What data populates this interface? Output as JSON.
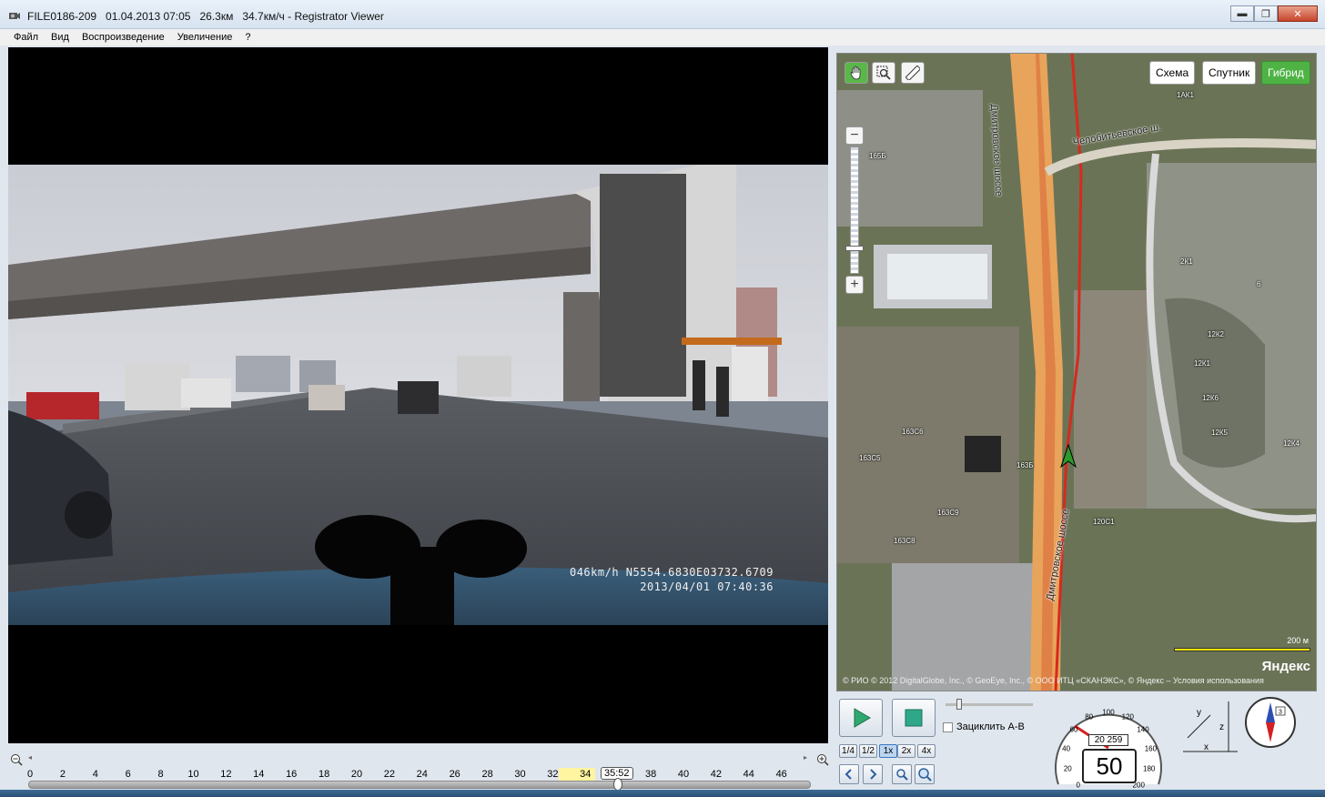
{
  "window": {
    "title": "FILE0186-209   01.04.2013 07:05   26.3км   34.7км/ч - Registrator Viewer",
    "controls": {
      "minimize": "▬",
      "maximize": "❐",
      "close": "✕"
    }
  },
  "menu": {
    "items": [
      "Файл",
      "Вид",
      "Воспроизведение",
      "Увеличение",
      "?"
    ]
  },
  "video": {
    "osd_line1": "046km/h N5554.6830E03732.6709",
    "osd_line2": "2013/04/01 07:40:36"
  },
  "map": {
    "tools": [
      "hand-icon",
      "zoom-select-icon",
      "ruler-icon"
    ],
    "types": [
      {
        "label": "Схема",
        "active": false
      },
      {
        "label": "Спутник",
        "active": false
      },
      {
        "label": "Гибрид",
        "active": true
      }
    ],
    "zoom_in": "+",
    "zoom_out": "−",
    "roads": {
      "dmitrovskoe_top": "Дмитровское шоссе",
      "dmitrovskoe_bottom": "Дмитровское шоссе",
      "chelobityevskoe": "Челобитьевское ш."
    },
    "building_labels": [
      {
        "id": "b1",
        "text": "1АК1"
      },
      {
        "id": "b2",
        "text": "165Б"
      },
      {
        "id": "b3",
        "text": "2К1"
      },
      {
        "id": "b4",
        "text": "6"
      },
      {
        "id": "b5",
        "text": "12К2"
      },
      {
        "id": "b6",
        "text": "12К1"
      },
      {
        "id": "b7",
        "text": "12К6"
      },
      {
        "id": "b8",
        "text": "12К5"
      },
      {
        "id": "b9",
        "text": "12К4"
      },
      {
        "id": "b10",
        "text": "163С6"
      },
      {
        "id": "b11",
        "text": "163С5"
      },
      {
        "id": "b12",
        "text": "163Б"
      },
      {
        "id": "b13",
        "text": "163С9"
      },
      {
        "id": "b14",
        "text": "120С1"
      },
      {
        "id": "b15",
        "text": "163С8"
      }
    ],
    "scale": "200 м",
    "brand": "Яндекс",
    "copyright": "© РИО   © 2012 DigitalGlobe, Inc., © GeoEye, Inc., © ООО ИТЦ «СКАНЭКС», © Яндекс – Условия использования"
  },
  "timeline": {
    "zoom_out_icon": "zoom-out-icon",
    "zoom_in_icon": "zoom-in-icon",
    "ticks": [
      "0",
      "2",
      "4",
      "6",
      "8",
      "10",
      "12",
      "14",
      "16",
      "18",
      "20",
      "22",
      "24",
      "26",
      "28",
      "30",
      "32",
      "34",
      "36",
      "38",
      "40",
      "42",
      "44",
      "46"
    ],
    "current_time": "35:52"
  },
  "controls": {
    "play": "play-icon",
    "stop": "stop-icon",
    "loop_label": "Зациклить А-В",
    "speeds": [
      {
        "label": "1/4",
        "active": false
      },
      {
        "label": "1/2",
        "active": false
      },
      {
        "label": "1x",
        "active": true
      },
      {
        "label": "2x",
        "active": false
      },
      {
        "label": "4x",
        "active": false
      }
    ],
    "speedometer": {
      "odometer": "20 259",
      "speed_limit": "50",
      "scale": [
        "0",
        "20",
        "40",
        "60",
        "80",
        "100",
        "120",
        "140",
        "160",
        "180",
        "200"
      ]
    },
    "axes": {
      "x": "x",
      "y": "y",
      "z": "z"
    },
    "compass_value": "3"
  }
}
